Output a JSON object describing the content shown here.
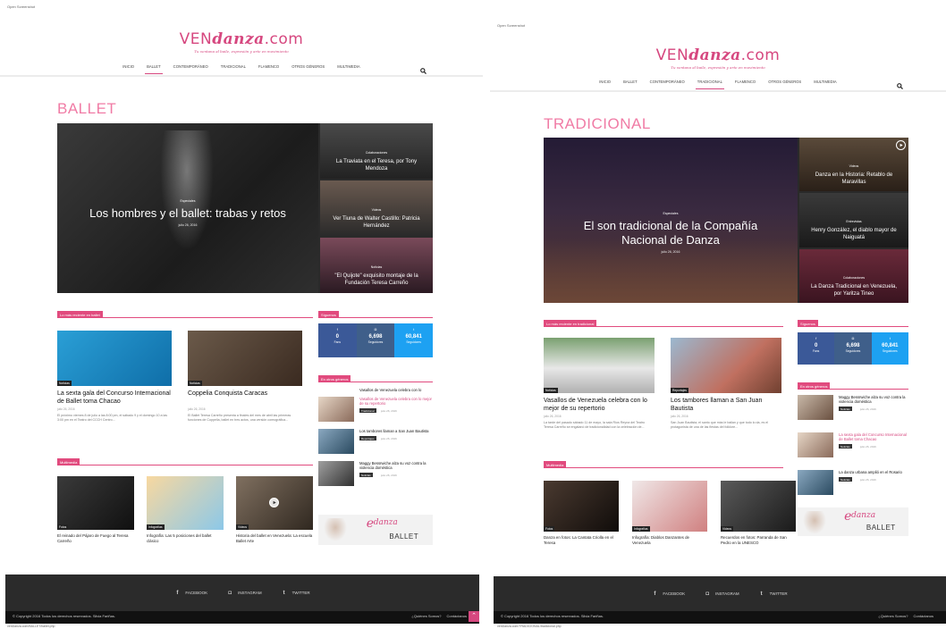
{
  "left": {
    "screen_label": "Open Screenshot",
    "logo": {
      "brand_pre": "VEN",
      "brand_mid": "danza",
      "brand_post": ".com",
      "tagline": "Tu ventana al baile, expresión y arte en movimiento"
    },
    "nav": [
      "INICIO",
      "BALLET",
      "CONTEMPORÁNEO",
      "TRADICIONAL",
      "FLAMENCO",
      "OTROS GÉNEROS",
      "MULTIMEDIA"
    ],
    "nav_active": 1,
    "category": "BALLET",
    "hero": {
      "main": {
        "tag": "Especiales",
        "title": "Los hombres y el ballet: trabas y retos",
        "date": "julio 26, 2016"
      },
      "side": [
        {
          "tag": "Colaboraciones",
          "title": "La Traviata en el Teresa, por Tony Mendoza"
        },
        {
          "tag": "Videos",
          "title": "Ver Tiuna de Walter Castillo: Patricia Hernández"
        },
        {
          "tag": "Noticias",
          "title": "\"El Quijote\" exquisito montaje de la Fundación Teresa Carreño"
        }
      ]
    },
    "recent_head": "Lo más reciente en ballet",
    "cards": [
      {
        "badge": "Noticias",
        "title": "La sexta gala del Concurso Internacional de Ballet toma Chacao",
        "date": "julio 26, 2016",
        "excerpt": "El próximo viernes 8 de julio a las 8:00 pm, el sábado 9 y el domingo 10 a las 3:00 pm en el Teatro del CCCH Centro..."
      },
      {
        "badge": "Noticias",
        "title": "Coppelia Conquista Caracas",
        "date": "julio 26, 2016",
        "excerpt": "El Ballet Teresa Carreño presenta a finales del mes de abril las primeras funciones de Coppelia, ballet en tres actos, una versión coreográfica..."
      }
    ],
    "multimedia_head": "Multimedia",
    "multimedia": [
      {
        "badge": "Fotos",
        "title": "El reinado del Pájaro de Fuego al Teresa Carreño"
      },
      {
        "badge": "Infografías",
        "title": "Infografía: Las 5 posiciones del ballet clásico"
      },
      {
        "badge": "Videos",
        "title": "Historia del ballet en Venezuela: La escuela Ballet Arte"
      }
    ],
    "follow_head": "Síguenos",
    "social": [
      {
        "icon": "f",
        "num": "0",
        "label": "Fans"
      },
      {
        "icon": "◘",
        "num": "6,698",
        "label": "Seguidores"
      },
      {
        "icon": "t",
        "num": "60,841",
        "label": "Seguidores"
      }
    ],
    "others_head": "En otros géneros",
    "others": [
      {
        "title": "Vasallos de Venezuela celebra con lo",
        "badge": "",
        "date": "",
        "pink": false
      },
      {
        "title": "Vasallos de Venezuela celebra con lo mejor de su repertorio",
        "badge": "Tradicional",
        "date": "julio 26, 2016",
        "pink": true
      },
      {
        "title": "Los tambores llaman a San Juan Bautista",
        "badge": "Reportajes",
        "date": "julio 26, 2016",
        "pink": false
      },
      {
        "title": "Maggy Bessrwiche alza su voz contra la violencia doméstica",
        "badge": "Noticias",
        "date": "julio 26, 2016",
        "pink": false
      }
    ],
    "banner": {
      "e": "e",
      "word1": "danza",
      "word2": "BALLET"
    },
    "footer": {
      "social": [
        {
          "icon": "f",
          "label": "FACEBOOK"
        },
        {
          "icon": "◘",
          "label": "INSTAGRAM"
        },
        {
          "icon": "t",
          "label": "TWITTER"
        }
      ],
      "copy": "© Copyright 2016 Todos los derechos reservados. Silvia Fariñas.",
      "links": [
        "¿Quiénes Somos?",
        "Contáctanos"
      ]
    },
    "url": "venDanza.com/BALLET/ballet.php"
  },
  "right": {
    "screen_label": "Open Screenshot",
    "logo": {
      "brand_pre": "VEN",
      "brand_mid": "danza",
      "brand_post": ".com",
      "tagline": "Tu ventana al baile, expresión y arte en movimiento"
    },
    "nav": [
      "INICIO",
      "BALLET",
      "CONTEMPORÁNEO",
      "TRADICIONAL",
      "FLAMENCO",
      "OTROS GÉNEROS",
      "MULTIMEDIA"
    ],
    "nav_active": 3,
    "category": "TRADICIONAL",
    "hero": {
      "main": {
        "tag": "Especiales",
        "title": "El son tradicional de la Compañía Nacional de Danza",
        "date": "julio 26, 2016"
      },
      "side": [
        {
          "tag": "Videos",
          "title": "Danza en la Historia: Retablo de Maravillas"
        },
        {
          "tag": "Entrevistas",
          "title": "Henry González, el diablo mayor de Naiguatá"
        },
        {
          "tag": "Colaboraciones",
          "title": "La Danza Tradicional en Venezuela, por Yaritza Tineo"
        }
      ]
    },
    "recent_head": "Lo más reciente en tradicional",
    "cards": [
      {
        "badge": "Noticias",
        "title": "Vasallos de Venezuela celebra con lo mejor de su repertorio",
        "date": "julio 26, 2016",
        "excerpt": "La tarde del pasado sábado 11 de mayo, la sala Ríos Reyna del Teatro Teresa Carreño se engalanó de tradicionalidad con la celebración de..."
      },
      {
        "badge": "Reportajes",
        "title": "Los tambores llaman a San Juan Bautista",
        "date": "julio 26, 2016",
        "excerpt": "San Juan Bautista, el santo que más le bailan y que todo lo da, es el protagonista de una de las fiestas del folklore..."
      }
    ],
    "multimedia_head": "Multimedia",
    "multimedia": [
      {
        "badge": "Fotos",
        "title": "Danza en fotos: La Cantata Criolla en el Teresa"
      },
      {
        "badge": "Infografías",
        "title": "Infografía: Diablos Danzantes de Venezuela"
      },
      {
        "badge": "Videos",
        "title": "Recuerdos en fotos: Parranda de San Pedro en la UNESCO"
      }
    ],
    "follow_head": "Síguenos",
    "social": [
      {
        "icon": "f",
        "num": "0",
        "label": "Fans"
      },
      {
        "icon": "◘",
        "num": "6,698",
        "label": "Seguidores"
      },
      {
        "icon": "t",
        "num": "60,841",
        "label": "Seguidores"
      }
    ],
    "others_head": "En otros géneros",
    "others": [
      {
        "title": "Maggy Bessrwiche alza su voz contra la violencia doméstica",
        "badge": "Noticias",
        "date": "julio 26, 2016",
        "pink": false
      },
      {
        "title": "La sexta gala del Concurso Internacional de Ballet toma Chacao",
        "badge": "Noticias",
        "date": "julio 26, 2016",
        "pink": true
      },
      {
        "title": "La danza urbana amplió en el Rosario",
        "badge": "Noticias",
        "date": "julio 26, 2016",
        "pink": false
      }
    ],
    "banner": {
      "e": "e",
      "word1": "danza",
      "word2": "BALLET"
    },
    "footer": {
      "social": [
        {
          "icon": "f",
          "label": "FACEBOOK"
        },
        {
          "icon": "◘",
          "label": "INSTAGRAM"
        },
        {
          "icon": "t",
          "label": "TWITTER"
        }
      ],
      "copy": "© Copyright 2016 Todos los derechos reservados. Silvia Fariñas.",
      "links": [
        "¿Quiénes Somos?",
        "Contáctanos"
      ]
    },
    "url": "venDanza.com/TRADICIONAL/tradicional.php"
  },
  "colors": {
    "accent": "#d6477f",
    "pink_title": "#f07ba5",
    "fb": "#3b5998",
    "ig": "#3f5f8a",
    "tw": "#1da1f2",
    "dark": "#2b2b2b"
  }
}
